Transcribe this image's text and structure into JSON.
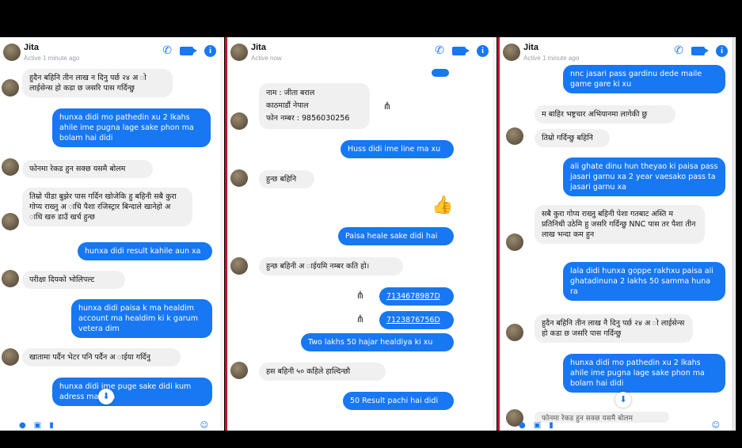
{
  "panels": [
    {
      "contact_name": "Jita",
      "status": "Active 1 minute ago",
      "messages": [
        "हुदैन बहिनि तीन लाख न दिनु पर्छ २४ अ ो लाईसेन्स हो कडा छ जसरि पास गर्दिन्छु",
        "hunxa didi mo pathedin xu 2 lkahs ahile ime pugna lage sake phon ma bolam hai didi",
        "फोनमा रेकड हुन सक्छ यसमै बोलम",
        "तिम्रो पीडा बुझेर पास गर्दिन खोजेकि हु बहिनी सबै कुरा गोप्य राख्नु अ ाधि पैशा रजिस्ट्रार बिन्दाले खानेहो अ ाधि खरु डाउँ खर्च हुन्छ",
        "hunxa didi result kahile aun xa",
        "परीक्षा दियको भोलिपल्ट",
        "hunxa didi paisa k ma healdim account ma healdim ki k garum vetera dim",
        "खातामा पर्दैन भेटर पनि पर्दैन अ ाईया गर्दिनु",
        "hunxa didi ime puge sake didi kum adress ma dim"
      ]
    },
    {
      "contact_name": "Jita",
      "status": "Active now",
      "messages": [
        "नाम : जीता बराल\nकाठमाडौं नेपाल\nफोन नम्बर : 9856030256",
        "Huss didi ime line ma xu",
        "हुन्छ बहिनि",
        "Paisa heale sake didi hai",
        "हुन्छ बहिनी अ ाईयमि नम्बर कति हो।",
        "7134678987D",
        "7123876756D",
        "Two lakhs 50 hajar healdiya ki xu",
        "हस बहिनी ५० कहिले हाल्दिन्छौ",
        "50 Result pachi hai didi"
      ]
    },
    {
      "contact_name": "Jita",
      "status": "Active 1 minute ago",
      "messages": [
        "nnc jasari pass gardinu dede maile game gare ki xu",
        "म बाहिर भष्ट्रचार अभियानमा लागेकी छु",
        "तिम्रो गर्दिन्छु बहिनि",
        "ali ghate dinu hun theyao ki paisa pass jasari garnu xa 2 year vaesako pass ta jasari garnu xa",
        "सबै कुरा गोप्य राख्नु बहिनी पेशा गतबाट अस्ति म प्रतिनिधी उठेमि हु जसरि गर्दिन्छु NNC पास तर पैशा तीन लाख भन्दा कम हुन",
        "lala didi hunxa goppe rakhxu paisa ali ghatadinuna 2 lakhs 50 samma huna ra",
        "हुदैन बहिनि तीन लाख नै दिनु पर्छ २४ अ ो लाईसेन्स हो कडा छ जसरि पास गर्दिन्छु",
        "hunxa didi mo pathedin xu 2 lkahs ahile ime pugna lage sake phon ma bolam hai didi",
        "फोनमा रेकड हुन सक्छ यसमै बोलम"
      ]
    }
  ],
  "colors": {
    "accent": "#1877f2",
    "divider": "#c8102e"
  },
  "icons": [
    "phone-icon",
    "video-icon",
    "info-icon",
    "share-icon",
    "like-icon",
    "scroll-down-icon",
    "camera-icon",
    "gallery-icon",
    "mic-icon",
    "emoji-icon"
  ]
}
